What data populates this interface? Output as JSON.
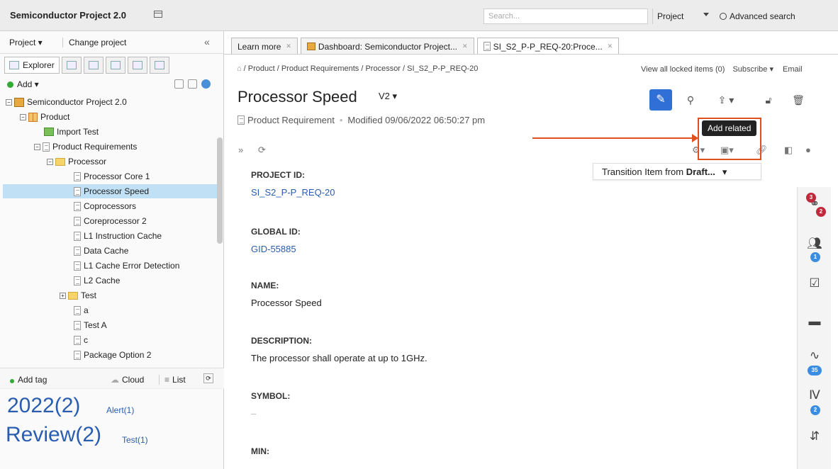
{
  "app": {
    "title": "Semiconductor Project 2.0"
  },
  "topbar": {
    "search_placeholder": "Search...",
    "scope": "Project",
    "advanced_search": "Advanced search"
  },
  "left": {
    "project_menu": "Project ▾",
    "change_project": "Change project",
    "collapse": "«",
    "explorer_tab": "Explorer",
    "add": "Add ▾",
    "tree": [
      {
        "label": "Semiconductor Project 2.0",
        "icon": "project-icon",
        "toggle": "−"
      },
      {
        "label": "Product",
        "icon": "grid-icon",
        "toggle": "−"
      },
      {
        "label": "Import Test",
        "icon": "import-icon",
        "toggle": ""
      },
      {
        "label": "Product Requirements",
        "icon": "doc-icon",
        "toggle": "−"
      },
      {
        "label": "Processor",
        "icon": "folder-icon",
        "toggle": "−"
      },
      {
        "label": "Processor Core 1",
        "icon": "doc-icon",
        "toggle": ""
      },
      {
        "label": "Processor Speed",
        "icon": "doc-icon",
        "toggle": "",
        "selected": true
      },
      {
        "label": "Coprocessors",
        "icon": "doc-icon",
        "toggle": ""
      },
      {
        "label": "Coreprocessor 2",
        "icon": "doc-icon",
        "toggle": ""
      },
      {
        "label": "L1 Instruction Cache",
        "icon": "doc-icon",
        "toggle": ""
      },
      {
        "label": "Data Cache",
        "icon": "doc-icon",
        "toggle": ""
      },
      {
        "label": "L1 Cache Error Detection",
        "icon": "doc-icon",
        "toggle": ""
      },
      {
        "label": "L2 Cache",
        "icon": "doc-icon",
        "toggle": ""
      },
      {
        "label": "Test",
        "icon": "folder-icon",
        "toggle": "+"
      },
      {
        "label": "a",
        "icon": "doc-icon",
        "toggle": ""
      },
      {
        "label": "Test A",
        "icon": "doc-icon",
        "toggle": ""
      },
      {
        "label": "c",
        "icon": "doc-icon",
        "toggle": ""
      },
      {
        "label": "Package Option 2",
        "icon": "doc-icon",
        "toggle": ""
      }
    ],
    "tags_bar": {
      "add_tag": "Add tag",
      "cloud": "Cloud",
      "list": "List"
    },
    "tags": [
      {
        "label": "2022(2)",
        "size": "big"
      },
      {
        "label": "Alert(1)",
        "size": "small"
      },
      {
        "label": "Review(2)",
        "size": "big"
      },
      {
        "label": "Test(1)",
        "size": "small"
      }
    ]
  },
  "main": {
    "tabs": [
      {
        "label": "Learn more"
      },
      {
        "label": "Dashboard: Semiconductor Project..."
      },
      {
        "label": "SI_S2_P-P_REQ-20:Proce..."
      }
    ],
    "breadcrumb": "/ Product / Product Requirements / Processor / SI_S2_P-P_REQ-20",
    "locked_items": "View all locked items (0)",
    "subscribe": "Subscribe ▾",
    "email": "Email",
    "title": "Processor Speed",
    "version": "V2 ▾",
    "item_type": "Product Requirement",
    "modified": "Modified 09/06/2022 06:50:27 pm",
    "tooltip": "Add related",
    "transition_prefix": "Transition Item from ",
    "transition_state": "Draft...",
    "fields": [
      {
        "label": "PROJECT ID:",
        "value": "SI_S2_P-P_REQ-20",
        "link": true
      },
      {
        "label": "GLOBAL ID:",
        "value": "GID-55885",
        "link": true
      },
      {
        "label": "NAME:",
        "value": "Processor Speed",
        "link": false
      },
      {
        "label": "DESCRIPTION:",
        "value": "The processor shall operate at up to 1GHz.",
        "link": false
      },
      {
        "label": "SYMBOL:",
        "value": "–",
        "link": false
      },
      {
        "label": "MIN:",
        "value": "",
        "link": false
      }
    ],
    "rail_badges": {
      "relations_top": "3",
      "relations_bottom": "2",
      "people": "1",
      "activity": "35",
      "versions": "2"
    }
  }
}
